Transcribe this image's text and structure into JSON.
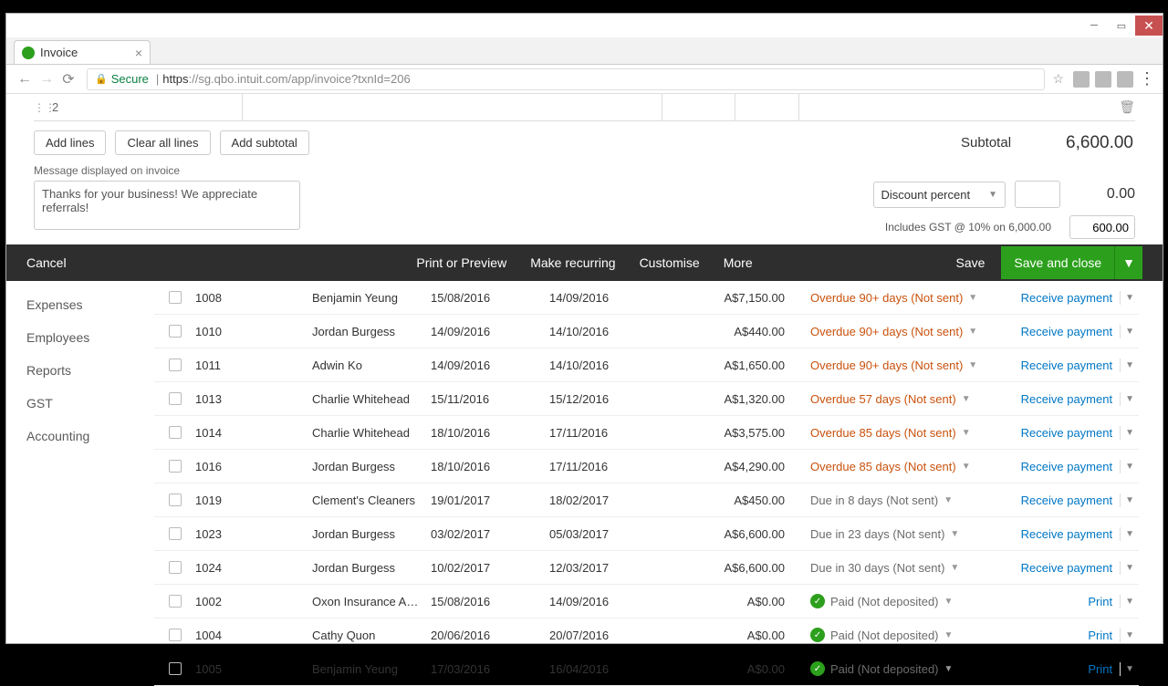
{
  "browser": {
    "tab_title": "Invoice",
    "secure_label": "Secure",
    "url": "https://sg.qbo.intuit.com/app/invoice?txnId=206"
  },
  "invoice": {
    "line_number": "2",
    "add_lines": "Add lines",
    "clear_lines": "Clear all lines",
    "add_subtotal": "Add subtotal",
    "subtotal_label": "Subtotal",
    "subtotal_value": "6,600.00",
    "message_label": "Message displayed on invoice",
    "message_value": "Thanks for your business!  We appreciate referrals!",
    "discount_select": "Discount percent",
    "discount_value": "0.00",
    "gst_label": "Includes GST @ 10% on 6,000.00",
    "gst_value": "600.00"
  },
  "actionbar": {
    "cancel": "Cancel",
    "print": "Print or Preview",
    "recurring": "Make recurring",
    "customise": "Customise",
    "more": "More",
    "save": "Save",
    "save_close": "Save and close"
  },
  "sidebar": {
    "items": [
      {
        "label": "Expenses"
      },
      {
        "label": "Employees"
      },
      {
        "label": "Reports"
      },
      {
        "label": "GST"
      },
      {
        "label": "Accounting"
      }
    ]
  },
  "table": {
    "receive_payment": "Receive payment",
    "print": "Print",
    "rows": [
      {
        "no": "1008",
        "cust": "Benjamin Yeung",
        "d1": "15/08/2016",
        "d2": "14/09/2016",
        "amt": "A$7,150.00",
        "status": "Overdue 90+ days (Not sent)",
        "st": "overdue",
        "action": "receive"
      },
      {
        "no": "1010",
        "cust": "Jordan Burgess",
        "d1": "14/09/2016",
        "d2": "14/10/2016",
        "amt": "A$440.00",
        "status": "Overdue 90+ days (Not sent)",
        "st": "overdue",
        "action": "receive"
      },
      {
        "no": "1011",
        "cust": "Adwin Ko",
        "d1": "14/09/2016",
        "d2": "14/10/2016",
        "amt": "A$1,650.00",
        "status": "Overdue 90+ days (Not sent)",
        "st": "overdue",
        "action": "receive"
      },
      {
        "no": "1013",
        "cust": "Charlie Whitehead",
        "d1": "15/11/2016",
        "d2": "15/12/2016",
        "amt": "A$1,320.00",
        "status": "Overdue 57 days (Not sent)",
        "st": "overdue",
        "action": "receive"
      },
      {
        "no": "1014",
        "cust": "Charlie Whitehead",
        "d1": "18/10/2016",
        "d2": "17/11/2016",
        "amt": "A$3,575.00",
        "status": "Overdue 85 days (Not sent)",
        "st": "overdue",
        "action": "receive"
      },
      {
        "no": "1016",
        "cust": "Jordan Burgess",
        "d1": "18/10/2016",
        "d2": "17/11/2016",
        "amt": "A$4,290.00",
        "status": "Overdue 85 days (Not sent)",
        "st": "overdue",
        "action": "receive"
      },
      {
        "no": "1019",
        "cust": "Clement's Cleaners",
        "d1": "19/01/2017",
        "d2": "18/02/2017",
        "amt": "A$450.00",
        "status": "Due in 8 days (Not sent)",
        "st": "due",
        "action": "receive"
      },
      {
        "no": "1023",
        "cust": "Jordan Burgess",
        "d1": "03/02/2017",
        "d2": "05/03/2017",
        "amt": "A$6,600.00",
        "status": "Due in 23 days (Not sent)",
        "st": "due",
        "action": "receive"
      },
      {
        "no": "1024",
        "cust": "Jordan Burgess",
        "d1": "10/02/2017",
        "d2": "12/03/2017",
        "amt": "A$6,600.00",
        "status": "Due in 30 days (Not sent)",
        "st": "due",
        "action": "receive"
      },
      {
        "no": "1002",
        "cust": "Oxon Insurance Age...",
        "d1": "15/08/2016",
        "d2": "14/09/2016",
        "amt": "A$0.00",
        "status": "Paid (Not deposited)",
        "st": "paid",
        "action": "print"
      },
      {
        "no": "1004",
        "cust": "Cathy Quon",
        "d1": "20/06/2016",
        "d2": "20/07/2016",
        "amt": "A$0.00",
        "status": "Paid (Not deposited)",
        "st": "paid",
        "action": "print"
      },
      {
        "no": "1005",
        "cust": "Benjamin Yeung",
        "d1": "17/03/2016",
        "d2": "16/04/2016",
        "amt": "A$0.00",
        "status": "Paid (Not deposited)",
        "st": "paid",
        "action": "print"
      }
    ]
  }
}
